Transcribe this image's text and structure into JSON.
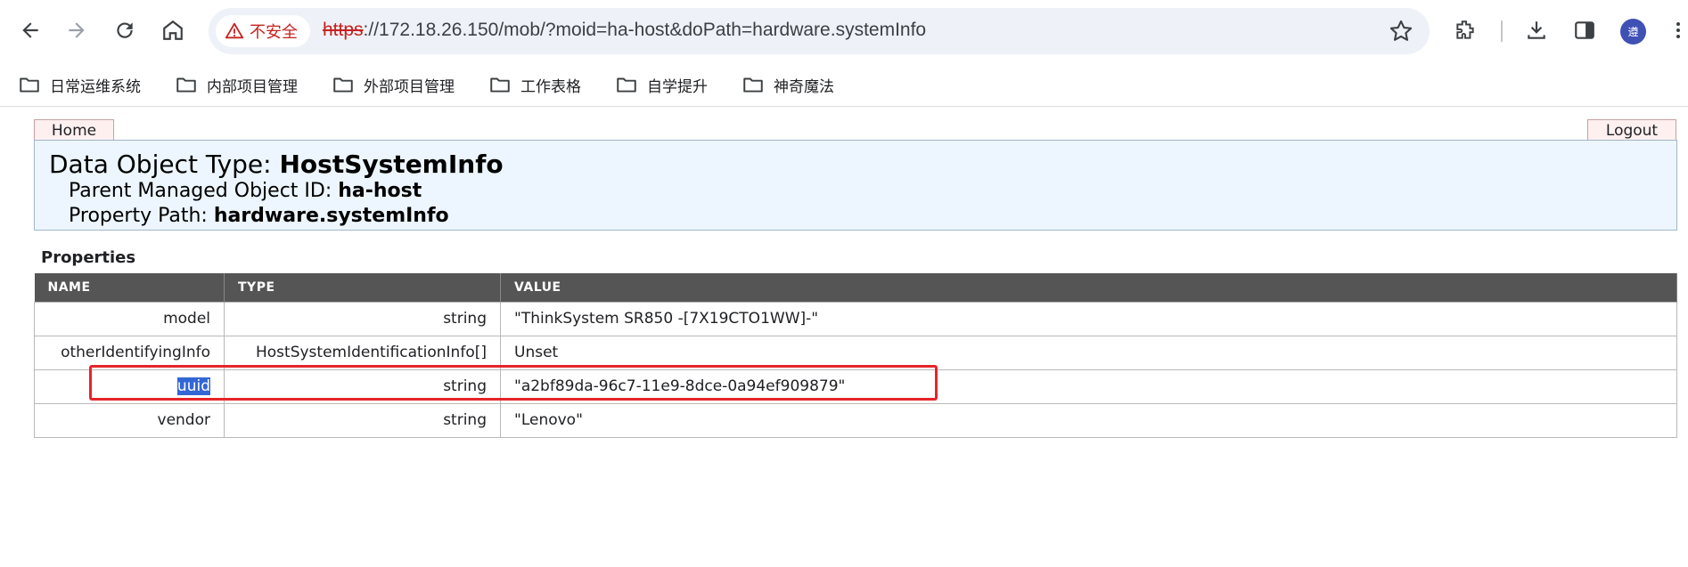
{
  "browser": {
    "security_label": "不安全",
    "url_scheme": "https",
    "url_rest": "://172.18.26.150/mob/?moid=ha-host&doPath=hardware.systemInfo",
    "avatar_text": "遵"
  },
  "bookmarks": [
    {
      "label": "日常运维系统",
      "icon": "folder-icon"
    },
    {
      "label": "内部项目管理",
      "icon": "folder-icon"
    },
    {
      "label": "外部项目管理",
      "icon": "folder-icon"
    },
    {
      "label": "工作表格",
      "icon": "folder-icon"
    },
    {
      "label": "自学提升",
      "icon": "folder-icon"
    },
    {
      "label": "神奇魔法",
      "icon": "folder-icon"
    }
  ],
  "page": {
    "home_label": "Home",
    "logout_label": "Logout",
    "data_object_type_label": "Data Object Type:",
    "data_object_type": "HostSystemInfo",
    "parent_moid_label": "Parent Managed Object ID:",
    "parent_moid": "ha-host",
    "property_path_label": "Property Path:",
    "property_path": "hardware.systemInfo",
    "properties_title": "Properties"
  },
  "table": {
    "headers": [
      "NAME",
      "TYPE",
      "VALUE"
    ],
    "rows": [
      {
        "name": "model",
        "type": "string",
        "value": "\"ThinkSystem SR850 -[7X19CTO1WW]-\""
      },
      {
        "name": "otherIdentifyingInfo",
        "type": "HostSystemIdentificationInfo[]",
        "value": "Unset"
      },
      {
        "name": "uuid",
        "type": "string",
        "value": "\"a2bf89da-96c7-11e9-8dce-0a94ef909879\""
      },
      {
        "name": "vendor",
        "type": "string",
        "value": "\"Lenovo\""
      }
    ]
  },
  "colors": {
    "highlight_box": "#e5252a",
    "selection": "#3367d6",
    "header_bg": "#edf6fe",
    "table_header_bg": "#555555"
  }
}
